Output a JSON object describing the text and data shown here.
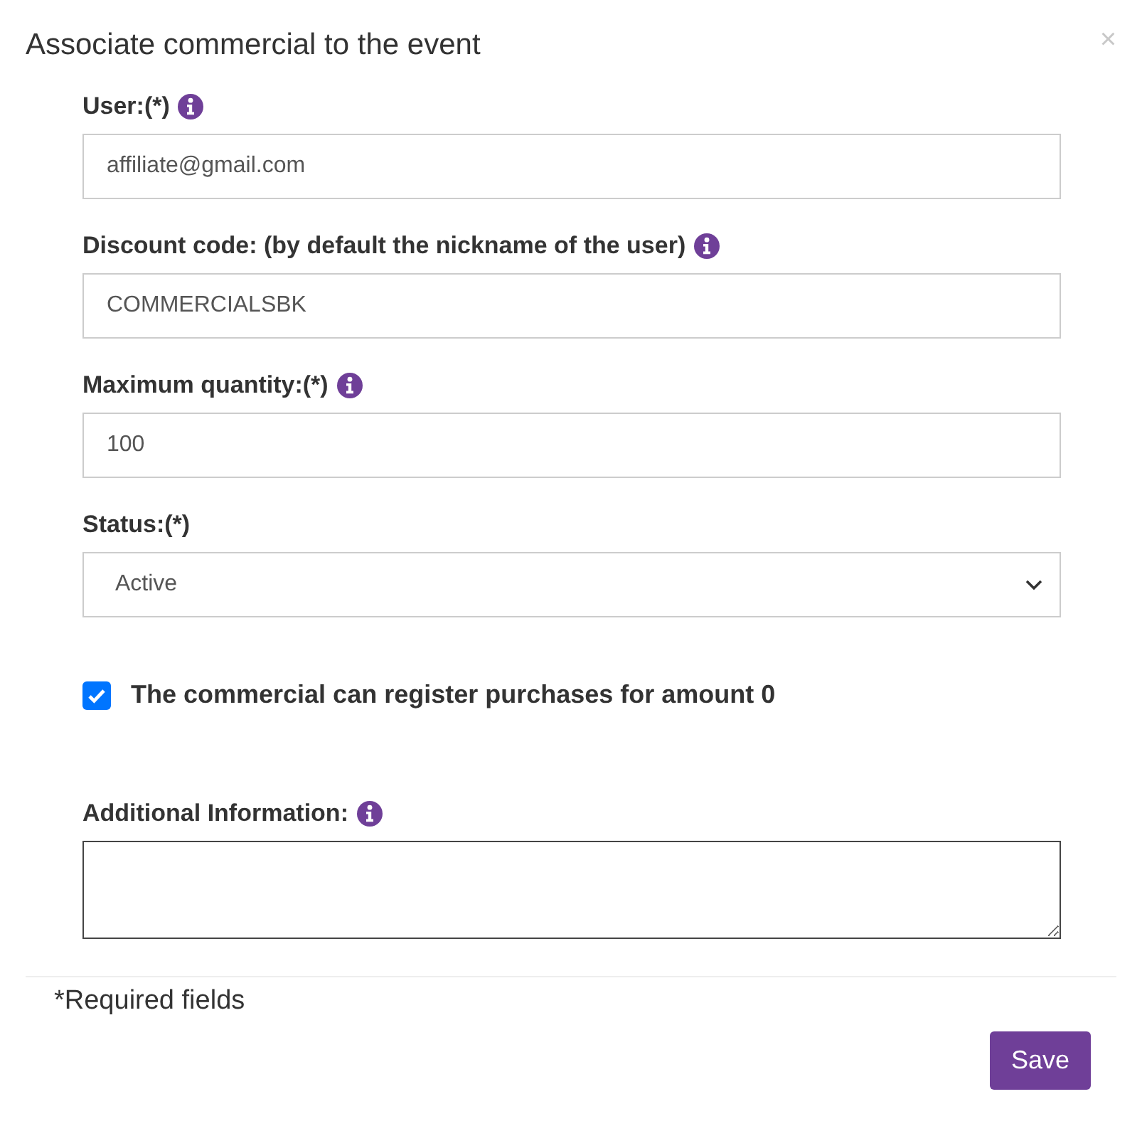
{
  "dialog": {
    "title": "Associate commercial to the event",
    "close": "×"
  },
  "fields": [
    {
      "kind": "text",
      "label": "User:(*)",
      "info": true,
      "value": "affiliate@gmail.com"
    },
    {
      "kind": "text",
      "label": "Discount code: (by default the nickname of the user)",
      "info": true,
      "value": "COMMERCIALSBK"
    },
    {
      "kind": "text",
      "label": "Maximum quantity:(*)",
      "info": true,
      "value": "100"
    },
    {
      "kind": "select",
      "label": "Status:(*)",
      "info": false,
      "value": "Active"
    },
    {
      "kind": "checkbox",
      "label": "The commercial can register purchases for amount 0",
      "checked": true
    },
    {
      "kind": "textarea",
      "label": "Additional Information:",
      "info": true
    }
  ],
  "footer": {
    "note": "*Required fields",
    "save": "Save"
  }
}
